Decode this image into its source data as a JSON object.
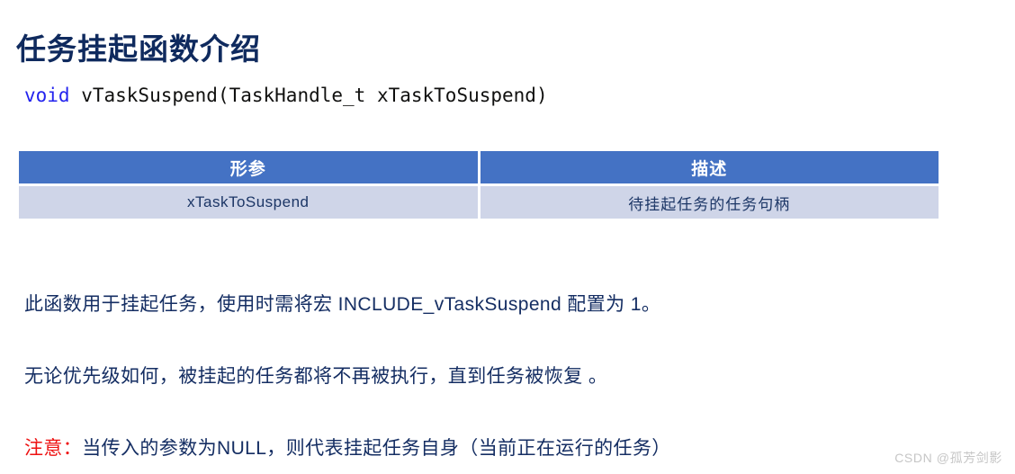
{
  "slide": {
    "title": "任务挂起函数介绍",
    "background_color": "#ffffff",
    "title_color": "#0F2A5E"
  },
  "code_signature": {
    "keyword": "void",
    "keyword_color": "#2323EE",
    "rest": " vTaskSuspend(TaskHandle_t xTaskToSuspend)",
    "full_text": "void vTaskSuspend(TaskHandle_t xTaskToSuspend)"
  },
  "param_table": {
    "header_color": "#4472C4",
    "row_color": "#CFD5E8",
    "headers": [
      "形参",
      "描述"
    ],
    "rows": [
      {
        "param": "xTaskToSuspend",
        "description": "待挂起任务的任务句柄"
      }
    ]
  },
  "paragraphs": [
    {
      "id": "usage-note",
      "text": "此函数用于挂起任务，使用时需将宏  INCLUDE_vTaskSuspend   配置为 1。",
      "color": "#152E63"
    },
    {
      "id": "priority-note",
      "text": "无论优先级如何，被挂起的任务都将不再被执行，直到任务被恢复 。",
      "color": "#152E63"
    }
  ],
  "notice": {
    "label": "注意：",
    "label_color": "#EE1111",
    "text": "当传入的参数为NULL，则代表挂起任务自身（当前正在运行的任务）",
    "text_color": "#152E63"
  },
  "watermark": {
    "text": "CSDN @孤芳剑影",
    "color": "#C6C6C6"
  }
}
